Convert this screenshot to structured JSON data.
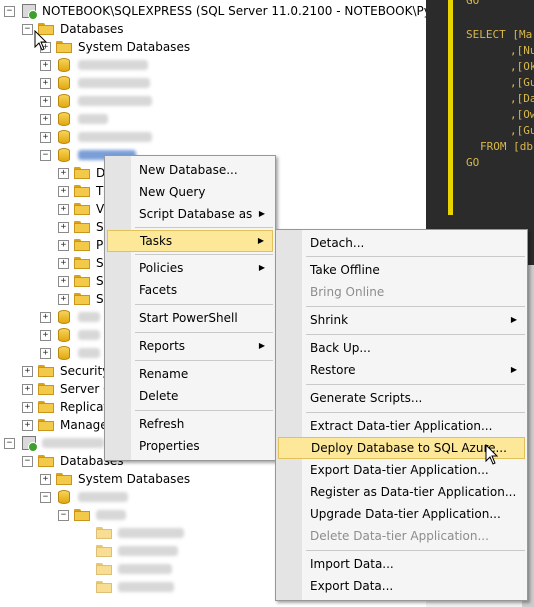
{
  "tree": {
    "server1_label": "NOTEBOOK\\SQLEXPRESS (SQL Server 11.0.2100 - NOTEBOOK\\Руслан)",
    "databases_label": "Databases",
    "system_databases_label": "System Databases",
    "sub_folders": [
      "D",
      "T",
      "V",
      "S",
      "P",
      "S",
      "S",
      "S"
    ],
    "security_label": "Security",
    "server_objects_label": "Server O",
    "replication_label": "Replicati",
    "management_label": "Manager",
    "databases2_label": "Databases",
    "system_databases2_label": "System Databases"
  },
  "context_menu": {
    "items": [
      {
        "label": "New Database...",
        "arrow": false
      },
      {
        "label": "New Query",
        "arrow": false
      },
      {
        "label": "Script Database as",
        "arrow": true
      },
      {
        "label": "Tasks",
        "arrow": true,
        "highlighted": true
      },
      {
        "label": "Policies",
        "arrow": true
      },
      {
        "label": "Facets",
        "arrow": false
      },
      {
        "label": "Start PowerShell",
        "arrow": false
      },
      {
        "label": "Reports",
        "arrow": true
      },
      {
        "label": "Rename",
        "arrow": false
      },
      {
        "label": "Delete",
        "arrow": false
      },
      {
        "label": "Refresh",
        "arrow": false
      },
      {
        "label": "Properties",
        "arrow": false
      }
    ]
  },
  "tasks_menu": {
    "items": [
      {
        "label": "Detach...",
        "arrow": false
      },
      {
        "label": "Take Offline",
        "arrow": false
      },
      {
        "label": "Bring Online",
        "disabled": true
      },
      {
        "label": "Shrink",
        "arrow": true
      },
      {
        "label": "Back Up...",
        "arrow": false
      },
      {
        "label": "Restore",
        "arrow": true
      },
      {
        "label": "Generate Scripts...",
        "arrow": false
      },
      {
        "label": "Extract Data-tier Application...",
        "arrow": false
      },
      {
        "label": "Deploy Database to SQL Azure...",
        "highlighted": true
      },
      {
        "label": "Export Data-tier Application...",
        "arrow": false
      },
      {
        "label": "Register as Data-tier Application...",
        "arrow": false
      },
      {
        "label": "Upgrade Data-tier Application...",
        "arrow": false
      },
      {
        "label": "Delete Data-tier Application...",
        "disabled": true
      },
      {
        "label": "Import Data...",
        "arrow": false
      },
      {
        "label": "Export Data...",
        "arrow": false
      }
    ]
  },
  "code": {
    "lines": [
      "GO",
      "SELECT [Ma",
      ",[Nu",
      ",[Ok",
      ",[Gu",
      ",[Da",
      ",[Ow",
      ",[Gu",
      "FROM [db",
      "GO"
    ]
  },
  "colors": {
    "highlight": "#fde89a",
    "code_background": "#2b2b2b",
    "code_text": "#d8b74a",
    "gutter_bar": "#e8d500"
  }
}
